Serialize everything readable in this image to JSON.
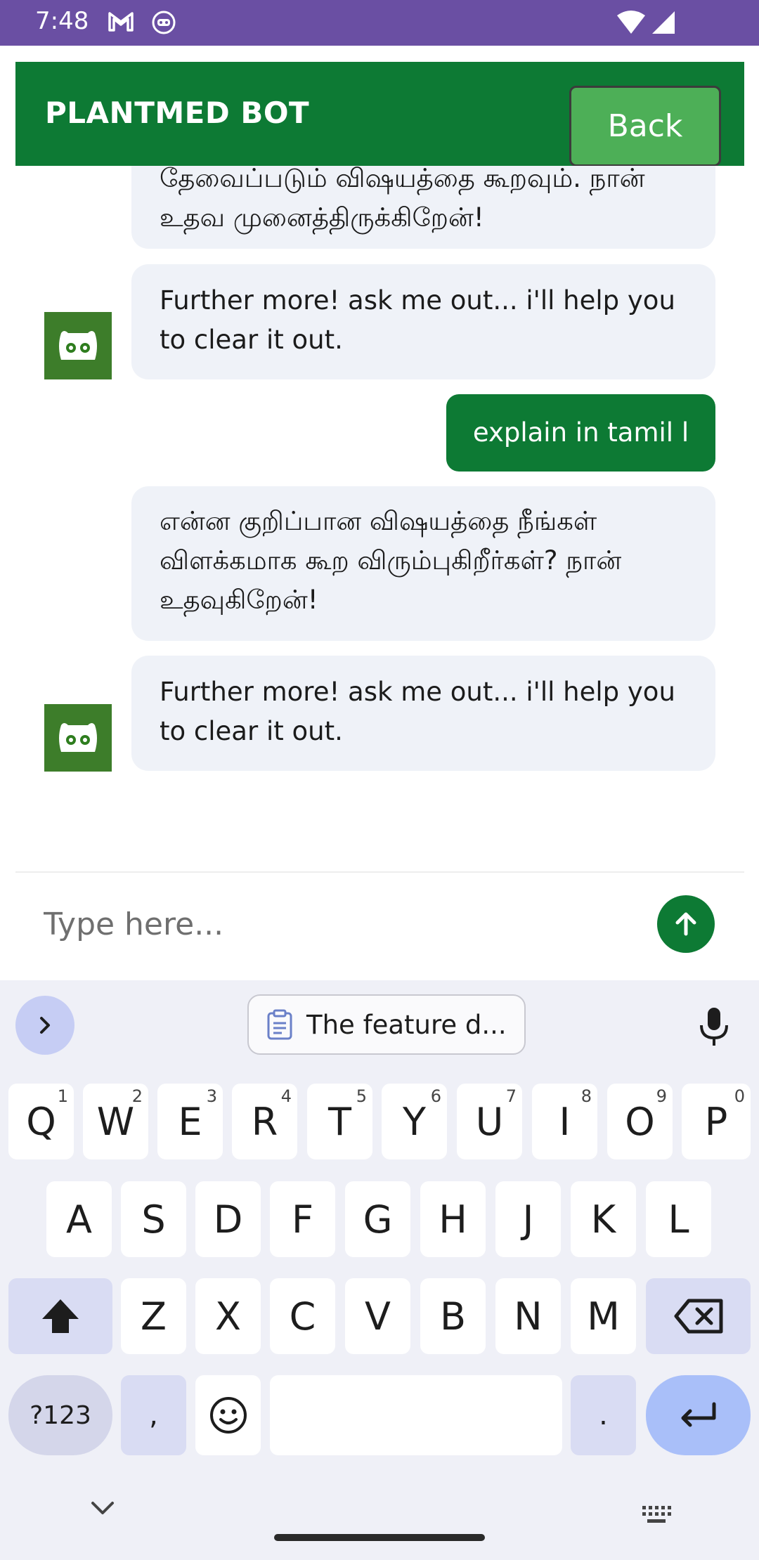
{
  "status_bar": {
    "time": "7:48",
    "icons": [
      "gmail-icon",
      "cat-app-icon",
      "wifi-icon",
      "signal-icon"
    ]
  },
  "header": {
    "title": "PLANTMED BOT",
    "back_label": "Back",
    "background_color": "#0d7a34",
    "button_color": "#4daf57"
  },
  "chat": {
    "messages": [
      {
        "sender": "bot",
        "text": "தேவைப்படும் விஷயத்தை கூறவும். நான் உதவ முனைத்திருக்கிறேன்!"
      },
      {
        "sender": "bot",
        "text": "Further more! ask me out... i'll help you to clear it out.",
        "avatar": "bot-avatar-icon"
      },
      {
        "sender": "user",
        "text": "explain in tamil l"
      },
      {
        "sender": "bot",
        "text": "என்ன குறிப்பான விஷயத்தை நீங்கள் விளக்கமாக கூற விரும்புகிறீர்கள்? நான் உதவுகிறேன்!"
      },
      {
        "sender": "bot",
        "text": "Further more! ask me out... i'll help you to clear it out.",
        "avatar": "bot-avatar-icon"
      }
    ]
  },
  "composer": {
    "placeholder": "Type here...",
    "send_icon": "arrow-up-icon"
  },
  "keyboard": {
    "clipboard_suggestion": "The feature d...",
    "row1": [
      {
        "key": "Q",
        "hint": "1"
      },
      {
        "key": "W",
        "hint": "2"
      },
      {
        "key": "E",
        "hint": "3"
      },
      {
        "key": "R",
        "hint": "4"
      },
      {
        "key": "T",
        "hint": "5"
      },
      {
        "key": "Y",
        "hint": "6"
      },
      {
        "key": "U",
        "hint": "7"
      },
      {
        "key": "I",
        "hint": "8"
      },
      {
        "key": "O",
        "hint": "9"
      },
      {
        "key": "P",
        "hint": "0"
      }
    ],
    "row2": [
      "A",
      "S",
      "D",
      "F",
      "G",
      "H",
      "J",
      "K",
      "L"
    ],
    "row3": [
      "Z",
      "X",
      "C",
      "V",
      "B",
      "N",
      "M"
    ],
    "symbols_label": "?123",
    "comma": ",",
    "period": "."
  }
}
